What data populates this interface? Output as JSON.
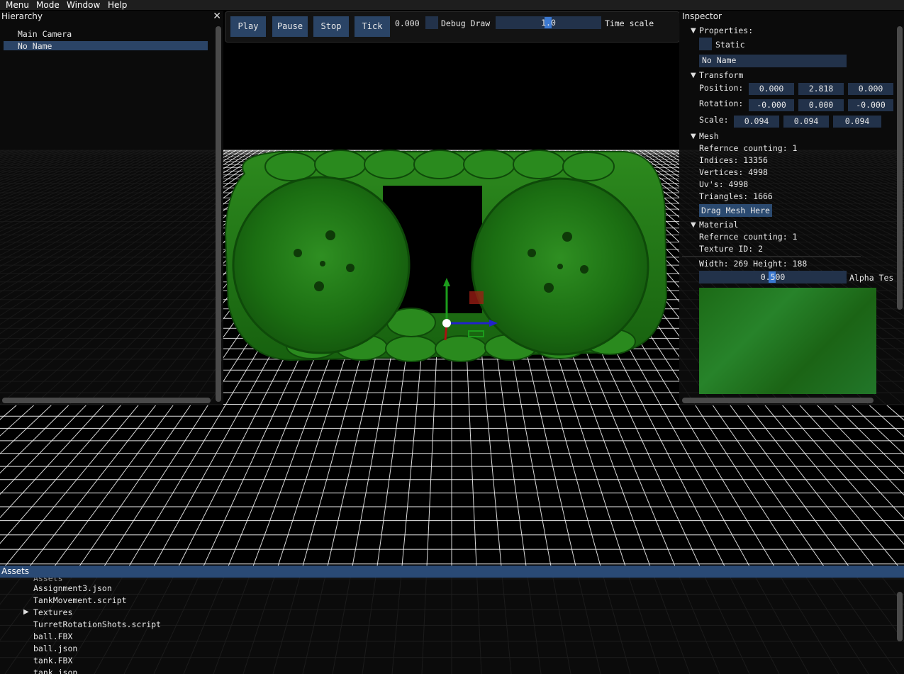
{
  "menu": [
    "Menu",
    "Mode",
    "Window",
    "Help"
  ],
  "hierarchy": {
    "title": "Hierarchy",
    "items": [
      "Main Camera",
      "No Name"
    ],
    "selected_index": 1
  },
  "toolbar": {
    "play": "Play",
    "pause": "Pause",
    "stop": "Stop",
    "tick": "Tick",
    "time": "0.000",
    "debug_draw": "Debug Draw",
    "time_scale_value": "1.0",
    "time_scale_label": "Time scale"
  },
  "inspector": {
    "title": "Inspector",
    "properties": {
      "header": "Properties:",
      "static_label": "Static",
      "name_value": "No Name"
    },
    "transform": {
      "header": "Transform",
      "position_label": "Position:",
      "position": [
        "0.000",
        "2.818",
        "0.000"
      ],
      "rotation_label": "Rotation:",
      "rotation": [
        "-0.000",
        "0.000",
        "-0.000"
      ],
      "scale_label": "Scale:",
      "scale": [
        "0.094",
        "0.094",
        "0.094"
      ]
    },
    "mesh": {
      "header": "Mesh",
      "ref_count": "Refernce counting: 1",
      "indices": "Indices: 13356",
      "vertices": "Vertices: 4998",
      "uvs": "Uv's: 4998",
      "triangles": "Triangles: 1666",
      "drag_button": "Drag Mesh Here"
    },
    "material": {
      "header": "Material",
      "ref_count": "Refernce counting: 1",
      "texture_id": "Texture ID: 2",
      "size": "Width: 269 Height: 188",
      "alpha_value": "0.500",
      "alpha_label": "Alpha Tes"
    }
  },
  "assets": {
    "title": "Assets",
    "items": [
      {
        "label": "Assignment3.json",
        "expandable": false
      },
      {
        "label": "TankMovement.script",
        "expandable": false
      },
      {
        "label": "Textures",
        "expandable": true
      },
      {
        "label": "TurretRotationShots.script",
        "expandable": false
      },
      {
        "label": "ball.FBX",
        "expandable": false
      },
      {
        "label": "ball.json",
        "expandable": false
      },
      {
        "label": "tank.FBX",
        "expandable": false
      },
      {
        "label": "tank.json",
        "expandable": false
      }
    ]
  },
  "colors": {
    "accent": "#2a4a75",
    "field_bg": "#22324a",
    "selection": "#2b4466",
    "grab": "#3b78d0",
    "mesh_green": "#1f7a14"
  },
  "icons": {
    "close": "close-icon",
    "collapse": "triangle-down-icon",
    "expand": "triangle-right-icon"
  }
}
